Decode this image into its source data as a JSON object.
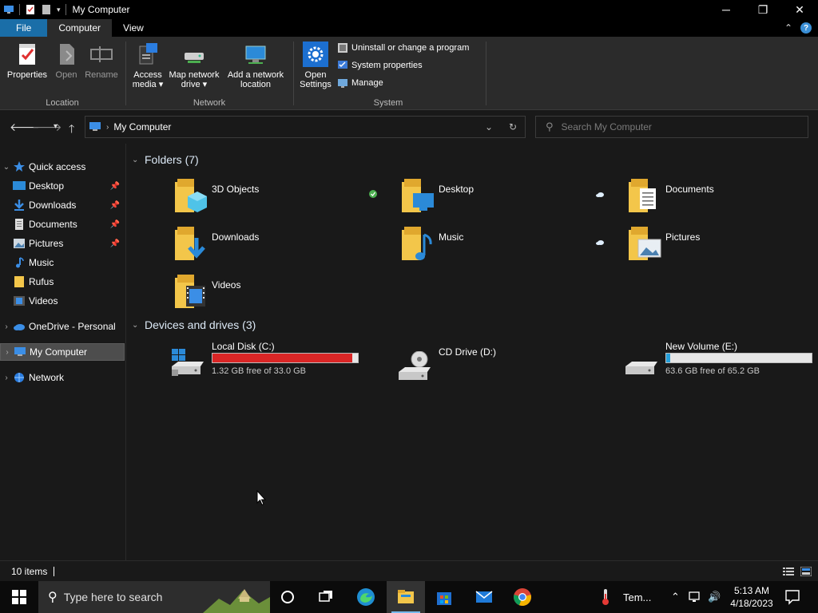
{
  "window": {
    "title": "My Computer"
  },
  "ribbon_tabs": [
    {
      "label": "File"
    },
    {
      "label": "Computer"
    },
    {
      "label": "View"
    }
  ],
  "ribbon": {
    "location": {
      "label": "Location",
      "buttons": [
        {
          "label": "Properties"
        },
        {
          "label": "Open"
        },
        {
          "label": "Rename"
        }
      ]
    },
    "network": {
      "label": "Network",
      "buttons": [
        {
          "line1": "Access",
          "line2": "media ▾"
        },
        {
          "line1": "Map network",
          "line2": "drive ▾"
        },
        {
          "line1": "Add a network",
          "line2": "location"
        }
      ]
    },
    "system": {
      "label": "System",
      "open_settings": {
        "line1": "Open",
        "line2": "Settings"
      },
      "items": [
        {
          "label": "Uninstall or change a program"
        },
        {
          "label": "System properties"
        },
        {
          "label": "Manage"
        }
      ]
    }
  },
  "address": {
    "crumb": "My Computer",
    "search_placeholder": "Search My Computer"
  },
  "sidebar": {
    "items": [
      {
        "label": "Quick access"
      },
      {
        "label": "Desktop"
      },
      {
        "label": "Downloads"
      },
      {
        "label": "Documents"
      },
      {
        "label": "Pictures"
      },
      {
        "label": "Music"
      },
      {
        "label": "Rufus"
      },
      {
        "label": "Videos"
      },
      {
        "label": "OneDrive - Personal"
      },
      {
        "label": "My Computer"
      },
      {
        "label": "Network"
      }
    ]
  },
  "folders": {
    "header": "Folders (7)",
    "items": [
      {
        "name": "3D Objects"
      },
      {
        "name": "Desktop"
      },
      {
        "name": "Documents"
      },
      {
        "name": "Downloads"
      },
      {
        "name": "Music"
      },
      {
        "name": "Pictures"
      },
      {
        "name": "Videos"
      }
    ]
  },
  "drives": {
    "header": "Devices and drives (3)",
    "items": [
      {
        "name": "Local Disk (C:)",
        "free": "1.32 GB free of 33.0 GB",
        "used_fraction": 0.96,
        "bar_color": "#da2626"
      },
      {
        "name": "CD Drive (D:)"
      },
      {
        "name": "New Volume (E:)",
        "free": "63.6 GB free of 65.2 GB",
        "used_fraction": 0.025,
        "bar_color": "#26a0da"
      }
    ]
  },
  "status": {
    "count": "10 items"
  },
  "taskbar": {
    "search_placeholder": "Type here to search",
    "weather": "Tem...",
    "time": "5:13 AM",
    "date": "4/18/2023"
  },
  "colors": {
    "accent": "#1a6ea8",
    "folder": "#f3c64a",
    "selection": "#4d4d4d"
  }
}
